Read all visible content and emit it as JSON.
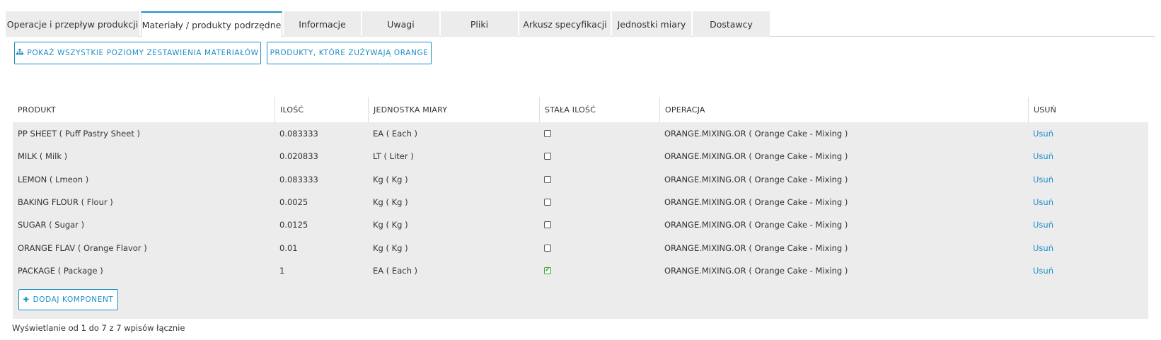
{
  "tabs": [
    {
      "label": "Operacje i przepływ produkcji",
      "active": false
    },
    {
      "label": "Materiały / produkty podrzędne",
      "active": true
    },
    {
      "label": "Informacje",
      "active": false
    },
    {
      "label": "Uwagi",
      "active": false
    },
    {
      "label": "Pliki",
      "active": false
    },
    {
      "label": "Arkusz specyfikacji",
      "active": false
    },
    {
      "label": "Jednostki miary",
      "active": false
    },
    {
      "label": "Dostawcy",
      "active": false
    }
  ],
  "actions": {
    "show_all_levels": "POKAŻ WSZYSTKIE POZIOMY ZESTAWIENIA MATERIAŁÓW",
    "show_all_levels_icon": "sitemap-icon",
    "products_using": "PRODUKTY, KTÓRE ZUŻYWAJĄ ORANGE",
    "add_component": "DODAJ KOMPONENT",
    "add_component_icon": "plus-icon"
  },
  "table": {
    "headers": {
      "product": "PRODUKT",
      "quantity": "ILOŚĆ",
      "unit": "JEDNOSTKA MIARY",
      "fixed": "STAŁA ILOŚĆ",
      "operation": "OPERACJA",
      "delete": "USUŃ"
    },
    "rows": [
      {
        "product": "PP SHEET ( Puff Pastry Sheet )",
        "quantity": "0.083333",
        "unit": "EA ( Each )",
        "fixed": false,
        "operation": "ORANGE.MIXING.OR ( Orange Cake - Mixing )",
        "delete": "Usuń"
      },
      {
        "product": "MILK ( Milk )",
        "quantity": "0.020833",
        "unit": "LT ( Liter )",
        "fixed": false,
        "operation": "ORANGE.MIXING.OR ( Orange Cake - Mixing )",
        "delete": "Usuń"
      },
      {
        "product": "LEMON ( Lmeon )",
        "quantity": "0.083333",
        "unit": "Kg ( Kg )",
        "fixed": false,
        "operation": "ORANGE.MIXING.OR ( Orange Cake - Mixing )",
        "delete": "Usuń"
      },
      {
        "product": "BAKING FLOUR ( Flour )",
        "quantity": "0.0025",
        "unit": "Kg ( Kg )",
        "fixed": false,
        "operation": "ORANGE.MIXING.OR ( Orange Cake - Mixing )",
        "delete": "Usuń"
      },
      {
        "product": "SUGAR ( Sugar )",
        "quantity": "0.0125",
        "unit": "Kg ( Kg )",
        "fixed": false,
        "operation": "ORANGE.MIXING.OR ( Orange Cake - Mixing )",
        "delete": "Usuń"
      },
      {
        "product": "ORANGE FLAV ( Orange Flavor )",
        "quantity": "0.01",
        "unit": "Kg ( Kg )",
        "fixed": false,
        "operation": "ORANGE.MIXING.OR ( Orange Cake - Mixing )",
        "delete": "Usuń"
      },
      {
        "product": "PACKAGE ( Package )",
        "quantity": "1",
        "unit": "EA ( Each )",
        "fixed": true,
        "operation": "ORANGE.MIXING.OR ( Orange Cake - Mixing )",
        "delete": "Usuń"
      }
    ]
  },
  "footer": {
    "info": "Wyświetlanie od 1 do 7 z 7 wpisów łącznie"
  },
  "colors": {
    "accent": "#1d8fc7",
    "row_background": "#ececec",
    "checked": "#3aa03a"
  }
}
